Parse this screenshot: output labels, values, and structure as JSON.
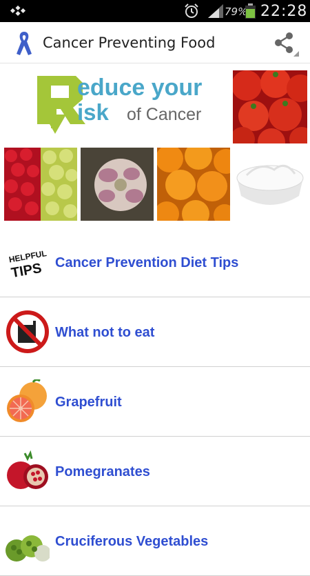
{
  "status_bar": {
    "battery_percent": "79%",
    "time": "22:28",
    "icons": [
      "notification-icon",
      "alarm-icon",
      "signal-icon",
      "battery-icon"
    ]
  },
  "app_bar": {
    "title": "Cancer Preventing Food",
    "app_icon": "awareness-ribbon-icon",
    "share_icon": "share-icon"
  },
  "banner": {
    "line1": "educe your",
    "line2": "isk",
    "line3": "of Cancer"
  },
  "colors": {
    "link_text": "#2f4ed1",
    "logo_green": "#a4c639",
    "logo_blue": "#4aa7c9"
  },
  "list": [
    {
      "label": "Cancer Prevention Diet Tips",
      "icon": "helpful-tips-icon"
    },
    {
      "label": "What not to eat",
      "icon": "no-eating-sign-icon"
    },
    {
      "label": "Grapefruit",
      "icon": "grapefruit-icon"
    },
    {
      "label": "Pomegranates",
      "icon": "pomegranate-icon"
    },
    {
      "label": "Cruciferous Vegetables",
      "icon": "cruciferous-vegetables-icon"
    }
  ]
}
